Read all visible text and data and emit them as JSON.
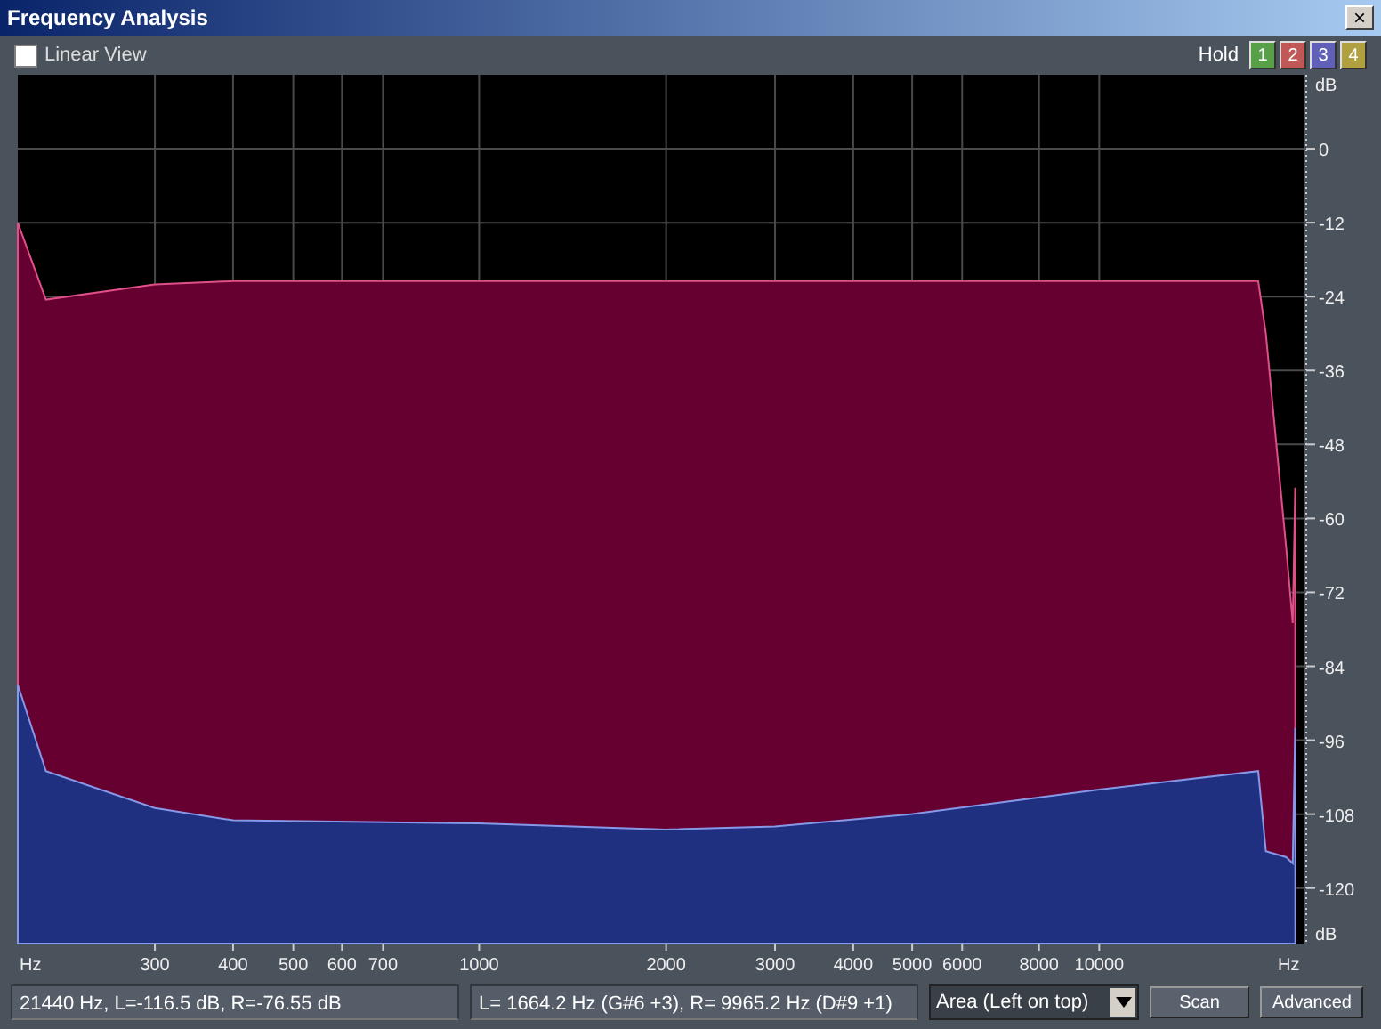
{
  "window": {
    "title": "Frequency Analysis",
    "close": "×"
  },
  "toolbar": {
    "linear_view": {
      "label": "Linear View",
      "checked": false
    },
    "hold_label": "Hold",
    "hold_buttons": [
      {
        "label": "1",
        "color": "#58a048"
      },
      {
        "label": "2",
        "color": "#c05858"
      },
      {
        "label": "3",
        "color": "#6060b8"
      },
      {
        "label": "4",
        "color": "#b0a040"
      }
    ]
  },
  "axis_units": {
    "y_top": "dB",
    "y_bottom": "dB",
    "x_left": "Hz",
    "x_right": "Hz"
  },
  "spectrum": {
    "channels": [
      {
        "color": "#660030"
      },
      {
        "color": "#203080"
      }
    ],
    "x_labels": [
      "300",
      "400",
      "500",
      "600",
      "700",
      "1000",
      "2000",
      "3000",
      "4000",
      "5000",
      "6000",
      "8000",
      "10000"
    ],
    "y_labels": [
      "0",
      "-12",
      "-24",
      "-36",
      "-48",
      "-60",
      "-72",
      "-84",
      "-96",
      "-108",
      "-120"
    ]
  },
  "status": {
    "cursor": "21440 Hz, L=-116.5 dB, R=-76.55 dB",
    "peaks": "L= 1664.2 Hz (G#6 +3), R= 9965.2 Hz (D#9 +1)",
    "mode": "Area (Left on top)",
    "buttons": [
      "Scan",
      "Advanced"
    ]
  }
}
